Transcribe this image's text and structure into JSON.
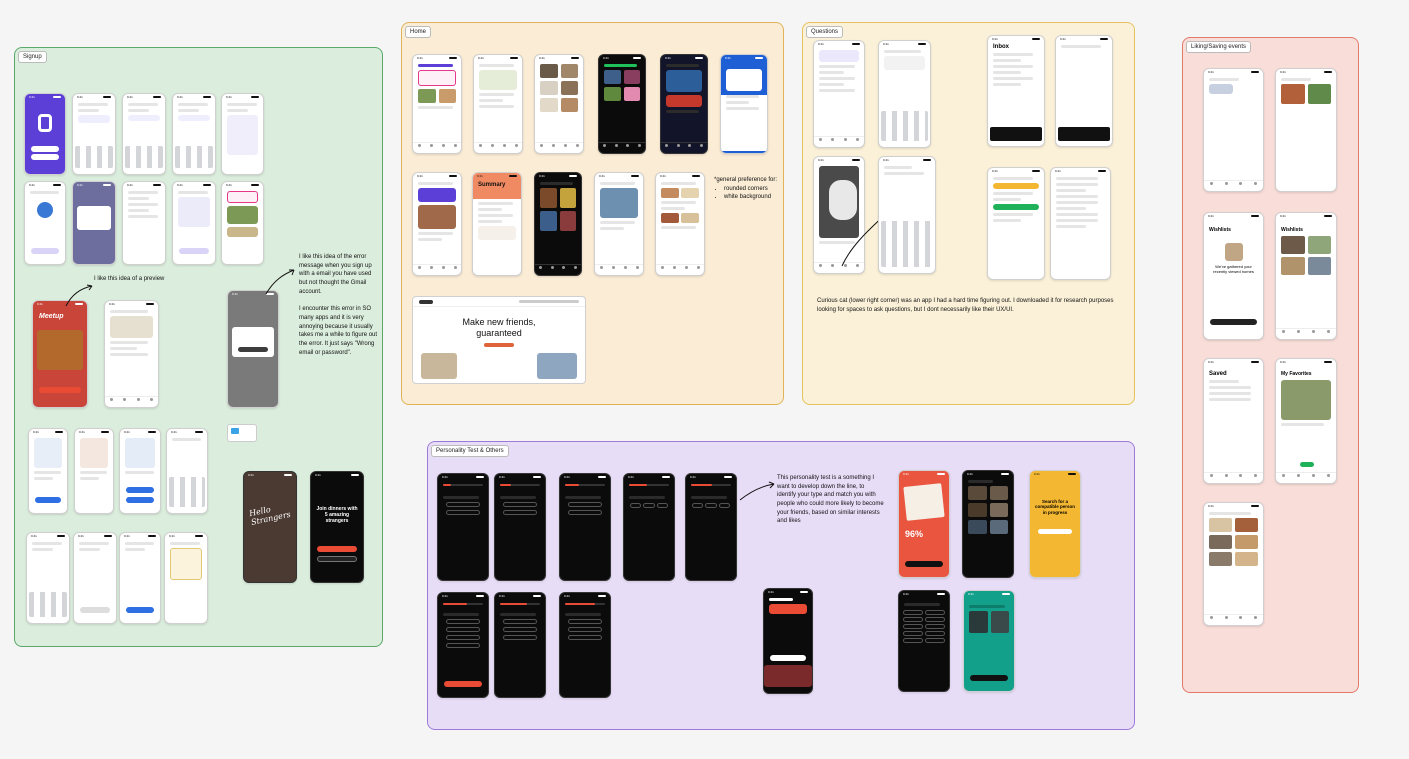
{
  "board": {
    "sections": {
      "signup": {
        "label": "Signup",
        "border": "#5aa86a",
        "fill": "#dbeddc"
      },
      "home": {
        "label": "Home",
        "border": "#e0b35a",
        "fill": "#faecd5"
      },
      "questions": {
        "label": "Questions",
        "border": "#e6c25c",
        "fill": "#fbf1d8"
      },
      "liking": {
        "label": "Liking/Saving events",
        "border": "#e27a6a",
        "fill": "#f9ddd8"
      },
      "personality": {
        "label": "Personality Test & Others",
        "border": "#9e7ad8",
        "fill": "#e8ddf7"
      }
    },
    "notes": {
      "preview": "I like this idea of a preview",
      "error": "I like this idea of the error message when you sign up with a email you have used but not thought the Gmail account.\n\nI encounter this error in SO many apps and it is very annoying because it usually takes me a while to figure out the error. It just says \"Wrong email or password\".",
      "general_heading": "*general preference for:",
      "general_items": [
        "rounded corners",
        "white background"
      ],
      "curious_cat": "Curious cat (lower right corner) was an app I had a hard time figuring out. I downloaded it for research purposes looking for spaces to ask questions, but I dont necessarily like their UX/UI.",
      "personality": "This personality test is a something I want to develop down the line, to identify your type and match you with people who could more likely to become your friends, based on similar interests and likes"
    },
    "screens": {
      "hello_strangers": "Hello Strangers",
      "join_dinners": "Join dinners with 5 amazing strangers",
      "make_friends": "Make new friends, guaranteed",
      "percent": "96%",
      "search_compatible": "Search for a compatible person in progress",
      "inbox": "Inbox",
      "summary": "Summary",
      "wishlists": "Wishlists",
      "saved": "Saved",
      "my_favorites": "My Favorites",
      "recently_viewed": "We've gathered your recently viewed homes"
    },
    "colors": {
      "accent_red": "#e94b35",
      "accent_blue": "#2f6fe4",
      "accent_purple": "#6a4bd8",
      "accent_yellow": "#f4b731",
      "accent_teal": "#12a08a"
    }
  }
}
